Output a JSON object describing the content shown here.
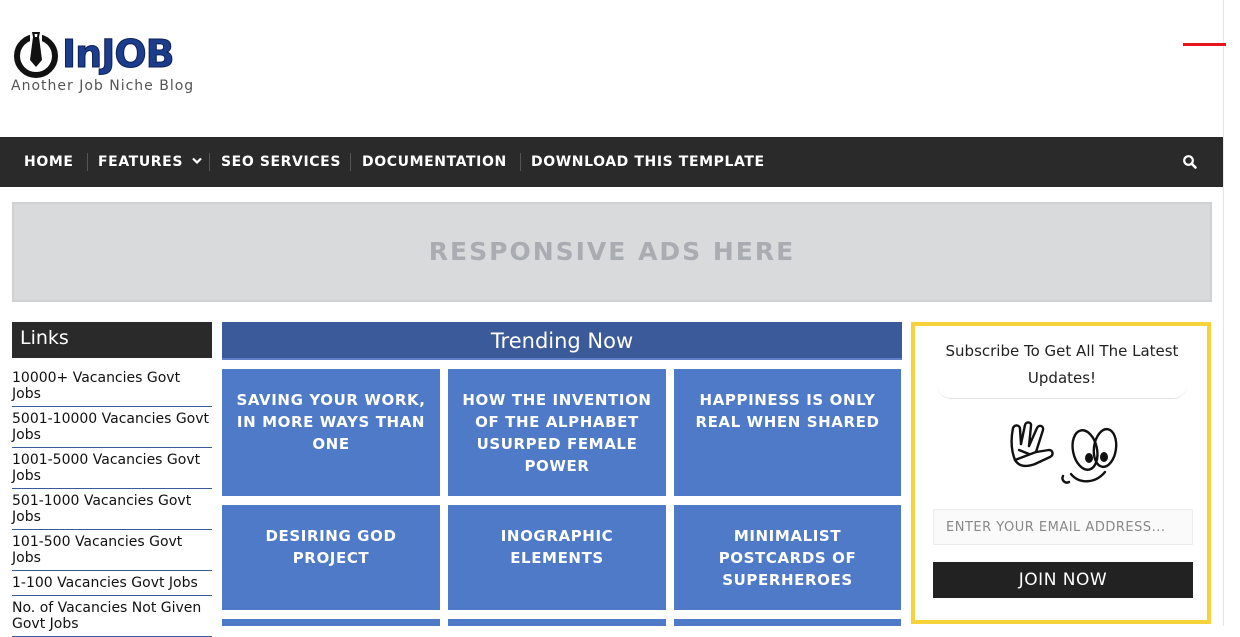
{
  "brand": {
    "logo_text": "InJOB",
    "tagline": "Another Job Niche Blog"
  },
  "nav": {
    "items": [
      {
        "label": "HOME"
      },
      {
        "label": "FEATURES"
      },
      {
        "label": "SEO SERVICES"
      },
      {
        "label": "DOCUMENTATION"
      },
      {
        "label": "DOWNLOAD THIS TEMPLATE"
      }
    ],
    "features_icon": "chevron-down-icon",
    "search_icon": "search-icon"
  },
  "ads": {
    "text": "RESPONSIVE ADS HERE"
  },
  "links": {
    "title": "Links",
    "items": [
      "10000+ Vacancies Govt Jobs",
      "5001-10000 Vacancies Govt Jobs",
      "1001-5000 Vacancies Govt Jobs",
      "501-1000 Vacancies Govt Jobs",
      "101-500 Vacancies Govt Jobs",
      "1-100 Vacancies Govt Jobs",
      "No. of Vacancies Not Given Govt Jobs"
    ]
  },
  "trending": {
    "title": "Trending Now",
    "cards": [
      "SAVING YOUR WORK, IN MORE WAYS THAN ONE",
      "HOW THE INVENTION OF THE ALPHABET USURPED FEMALE POWER",
      "HAPPINESS IS ONLY REAL WHEN SHARED",
      "DESIRING GOD PROJECT",
      "INOGRAPHIC ELEMENTS",
      "MINIMALIST POSTCARDS OF SUPERHEROES",
      "",
      "",
      ""
    ]
  },
  "subscribe": {
    "text": "Subscribe To Get All The Latest Updates!",
    "email_placeholder": "ENTER YOUR EMAIL ADDRESS...",
    "button_label": "JOIN NOW"
  },
  "colors": {
    "nav_bg": "#2a2a2a",
    "trending_title_bg": "#3b5a9a",
    "card_bg": "#4e7ac7",
    "subscribe_border": "#f6d33b",
    "accent_red": "#e8141e"
  }
}
